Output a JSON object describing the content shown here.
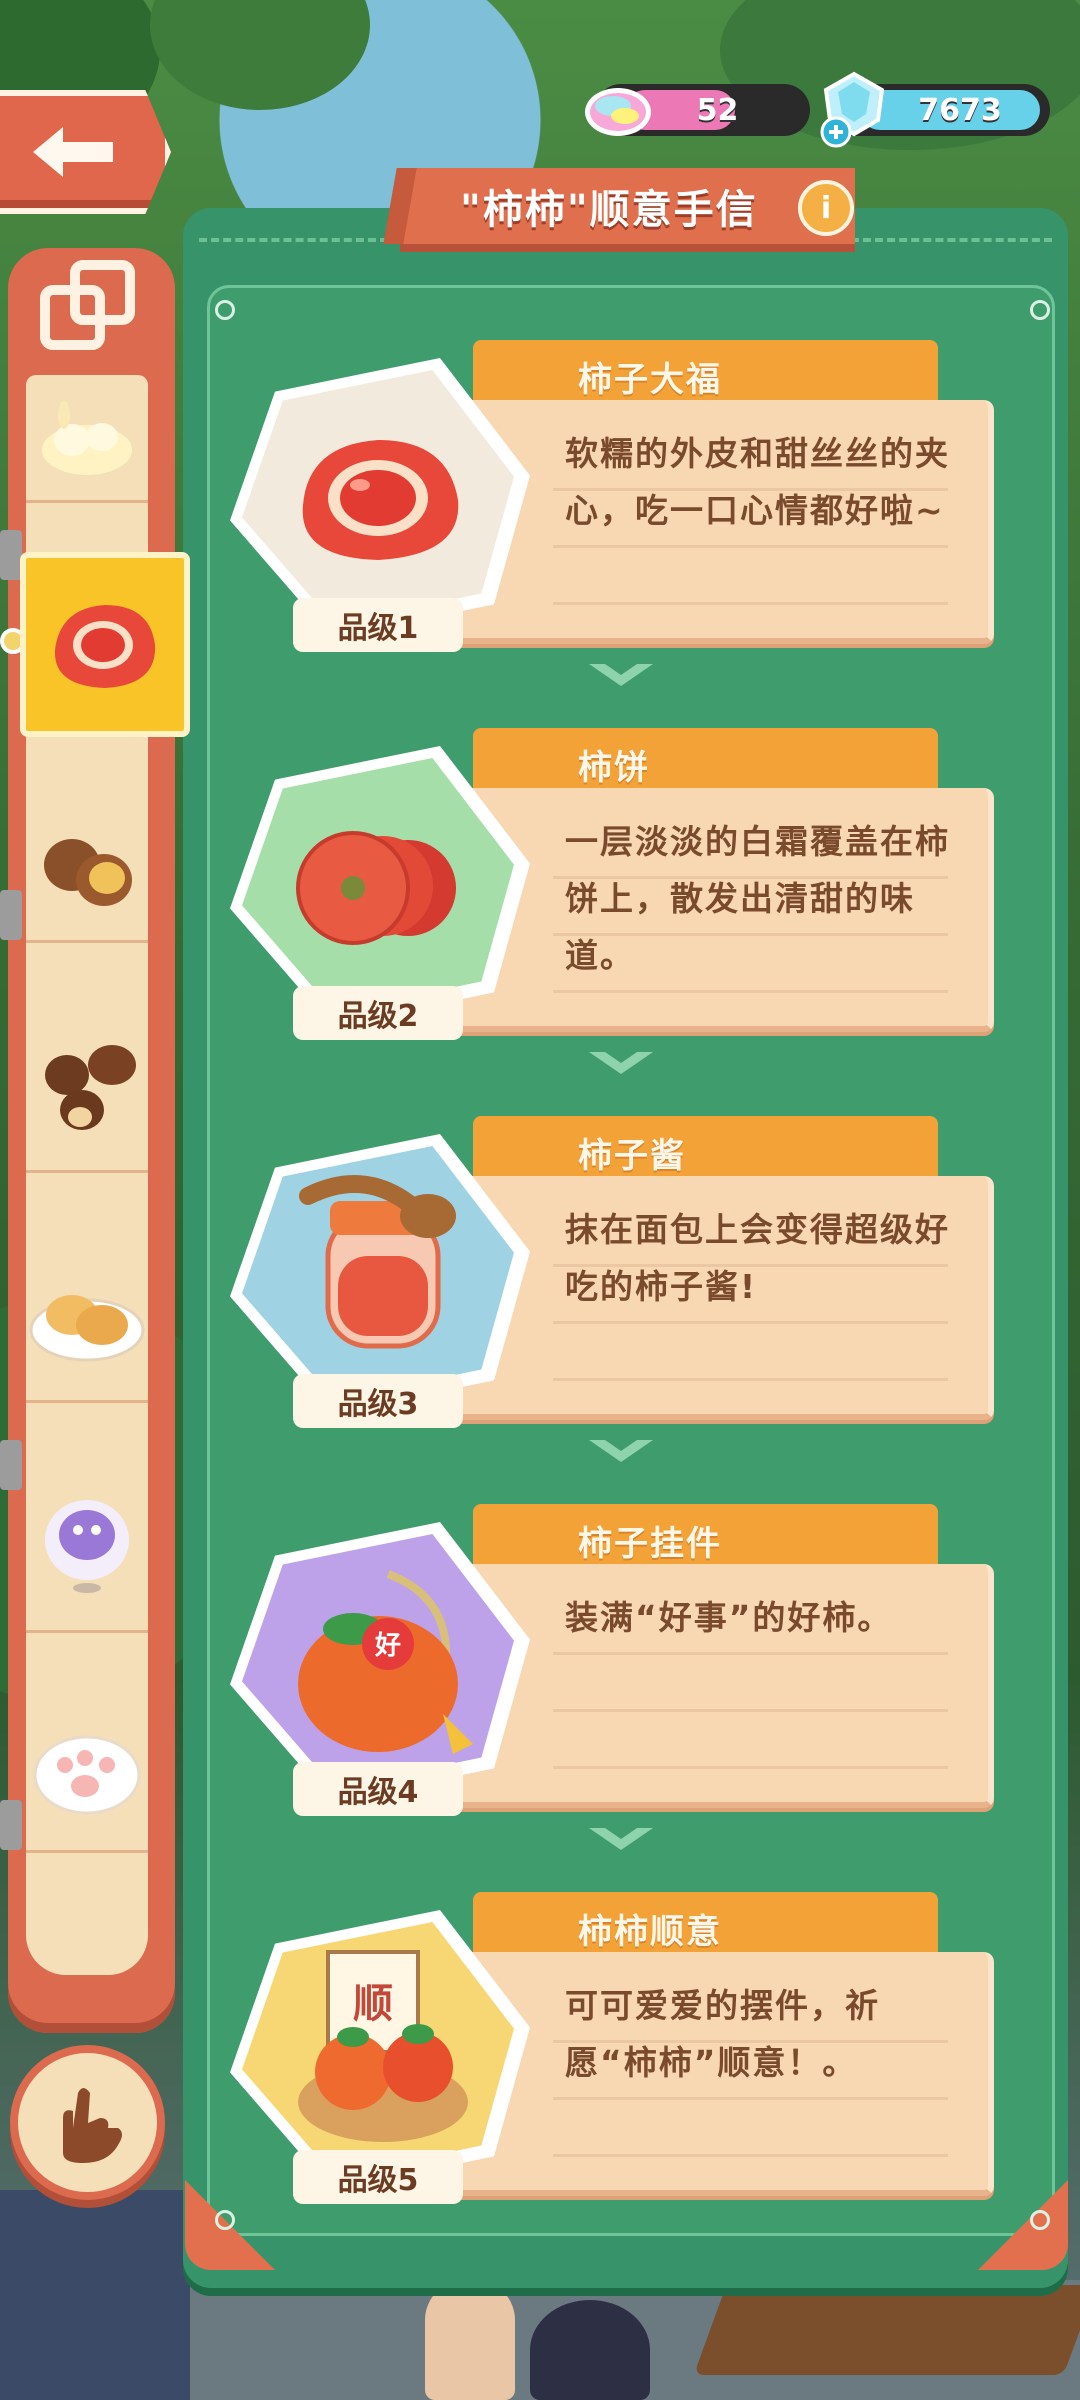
{
  "title": "\"柿柿\"顺意手信",
  "info_icon": "i",
  "currencies": {
    "cotton_candy": {
      "value": "52",
      "icon": "rainbow-cloud-icon"
    },
    "diamond": {
      "value": "7673",
      "icon": "diamond-icon",
      "add_icon": "plus-icon"
    }
  },
  "colors": {
    "panel_green": "#37946a",
    "ribbon_red": "#e06f4d",
    "banner_orange": "#f3a238",
    "desc_bg": "#f8d7b3",
    "desc_text": "#7a4a2c",
    "active_tab": "#f8c428"
  },
  "sidebar": {
    "items": [
      {
        "name": "bunny-dessert",
        "icon": "bunny-pastry-icon"
      },
      {
        "name": "persimmon-daifuku",
        "icon": "red-mochi-icon",
        "active": true
      },
      {
        "name": "chestnuts",
        "icon": "chestnut-icon"
      },
      {
        "name": "mushrooms",
        "icon": "brown-nut-icon"
      },
      {
        "name": "mooncake-plate",
        "icon": "mooncake-plate-icon"
      },
      {
        "name": "purple-cloud",
        "icon": "purple-ghost-icon"
      },
      {
        "name": "cat-paw",
        "icon": "cat-paw-icon"
      }
    ],
    "hand_icon": "pointing-hand-icon"
  },
  "items": [
    {
      "name": "柿子大福",
      "desc": "软糯的外皮和甜丝丝的夹心，吃一口心情都好啦~",
      "grade": "品级1",
      "hex_color": "#f2eadc"
    },
    {
      "name": "柿饼",
      "desc": "一层淡淡的白霜覆盖在柿饼上，散发出清甜的味道。",
      "grade": "品级2",
      "hex_color": "#a6deaa"
    },
    {
      "name": "柿子酱",
      "desc": "抹在面包上会变得超级好吃的柿子酱!",
      "grade": "品级3",
      "hex_color": "#9fd3e3"
    },
    {
      "name": "柿子挂件",
      "desc": "装满“好事”的好柿。",
      "grade": "品级4",
      "hex_color": "#bda2ea"
    },
    {
      "name": "柿柿顺意",
      "desc": "可可爱爱的摆件，祈愿“柿柿”顺意！。",
      "grade": "品级5",
      "hex_color": "#f7d774"
    }
  ]
}
